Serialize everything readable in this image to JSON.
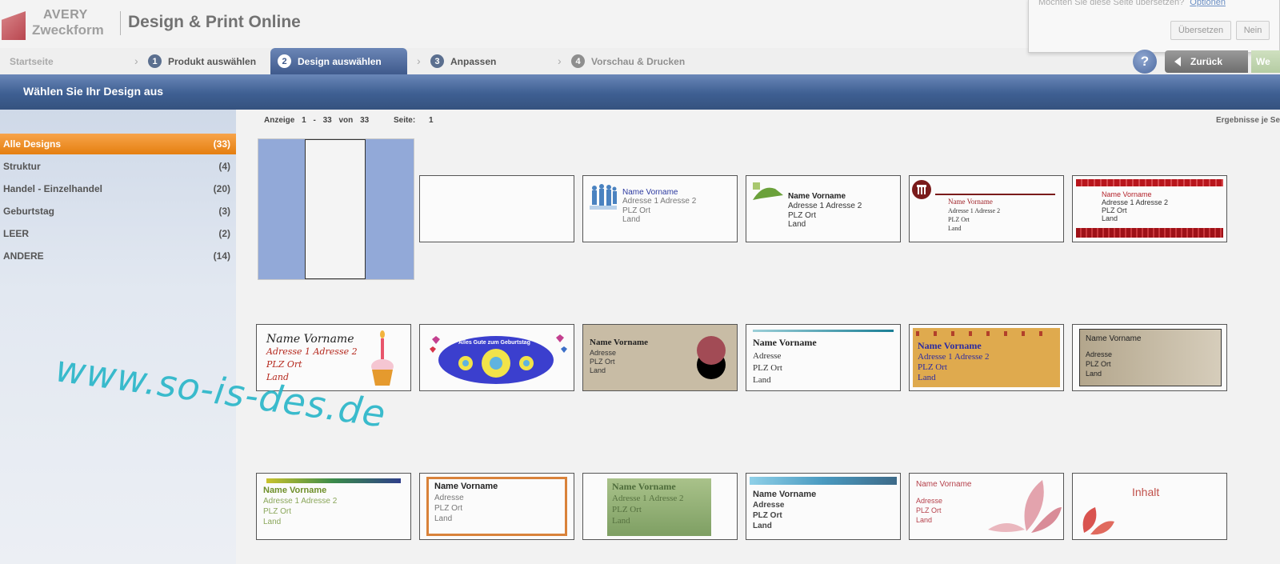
{
  "header": {
    "brand_line1": "AVERY",
    "brand_line2": "Zweckform",
    "app_title": "Design & Print Online"
  },
  "translate": {
    "prompt": "Möchten Sie diese Seite übersetzen?",
    "options": "Optionen",
    "translate_button": "Übersetzen",
    "no_button": "Nein"
  },
  "steps": {
    "start": "Startseite",
    "items": [
      {
        "num": "1",
        "label": "Produkt auswählen"
      },
      {
        "num": "2",
        "label": "Design auswählen"
      },
      {
        "num": "3",
        "label": "Anpassen"
      },
      {
        "num": "4",
        "label": "Vorschau & Drucken"
      }
    ],
    "help": "?",
    "back": "Zurück",
    "next": "We"
  },
  "banner": {
    "title": "Wählen Sie Ihr Design aus"
  },
  "sidebar": {
    "categories": [
      {
        "label": "Alle Designs",
        "count": "(33)"
      },
      {
        "label": "Struktur",
        "count": "(4)"
      },
      {
        "label": "Handel - Einzelhandel",
        "count": "(20)"
      },
      {
        "label": "Geburtstag",
        "count": "(3)"
      },
      {
        "label": "LEER",
        "count": "(2)"
      },
      {
        "label": "ANDERE",
        "count": "(14)"
      }
    ]
  },
  "watermark": "www.so-is-des.de",
  "paging": {
    "label": "Anzeige",
    "from": "1",
    "dash": "-",
    "to": "33",
    "of_label": "von",
    "total": "33",
    "page_label": "Seite:",
    "page": "1",
    "results_label": "Ergebnisse je Se"
  },
  "cards": {
    "c3": [
      "Name Vorname",
      "Adresse 1 Adresse 2",
      "PLZ Ort",
      "Land"
    ],
    "c4": [
      "Name Vorname",
      "Adresse 1 Adresse 2",
      "PLZ Ort",
      "Land"
    ],
    "c5": [
      "Name Vorname",
      "Adresse 1 Adresse 2",
      "PLZ Ort",
      "Land"
    ],
    "c6": [
      "Name Vorname",
      "Adresse 1 Adresse 2",
      "PLZ Ort",
      "Land"
    ],
    "c7": [
      "Name Vorname",
      "Adresse 1 Adresse 2",
      "PLZ Ort",
      "Land"
    ],
    "c8": [
      "Alles Gute zum Geburtstag"
    ],
    "c9": [
      "Name Vorname",
      "Adresse",
      "PLZ Ort",
      "Land"
    ],
    "c10": [
      "Name Vorname",
      "Adresse",
      "PLZ Ort",
      "Land"
    ],
    "c11": [
      "Name Vorname",
      "Adresse 1 Adresse 2",
      "PLZ Ort",
      "Land"
    ],
    "c12": [
      "Name Vorname",
      "Adresse",
      "PLZ Ort",
      "Land"
    ],
    "c13": [
      "Name Vorname",
      "Adresse 1 Adresse 2",
      "PLZ Ort",
      "Land"
    ],
    "c14": [
      "Name Vorname",
      "Adresse",
      "PLZ Ort",
      "Land"
    ],
    "c15": [
      "Name Vorname",
      "Adresse 1 Adresse 2",
      "PLZ Ort",
      "Land"
    ],
    "c16": [
      "Name Vorname",
      "Adresse",
      "PLZ Ort",
      "Land"
    ],
    "c17": [
      "Name Vorname",
      "Adresse",
      "PLZ Ort",
      "Land"
    ],
    "c18": [
      "Inhalt"
    ]
  },
  "colors": {
    "accent_orange": "#e57f10",
    "banner_blue": "#3e5f92",
    "watermark_cyan": "#2bb7c9"
  }
}
